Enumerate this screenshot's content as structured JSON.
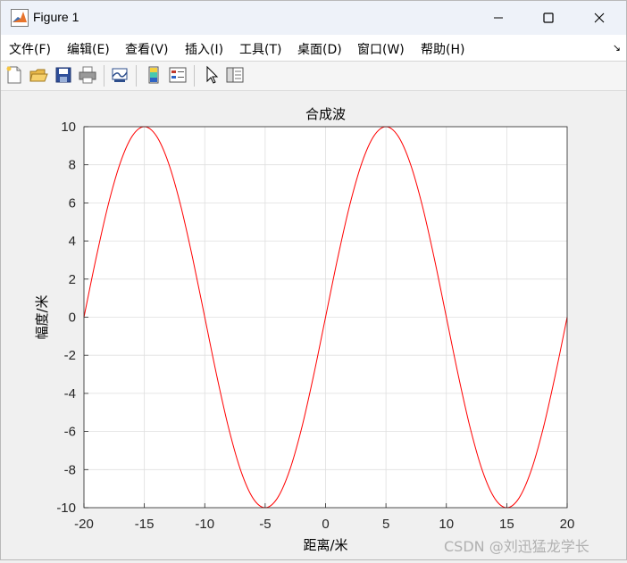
{
  "window": {
    "title": "Figure 1"
  },
  "menu": {
    "items": [
      {
        "label": "文件(F)"
      },
      {
        "label": "编辑(E)"
      },
      {
        "label": "查看(V)"
      },
      {
        "label": "插入(I)"
      },
      {
        "label": "工具(T)"
      },
      {
        "label": "桌面(D)"
      },
      {
        "label": "窗口(W)"
      },
      {
        "label": "帮助(H)"
      }
    ],
    "corner_icon": "dock-arrow-icon"
  },
  "toolbar": {
    "icons": [
      "new-figure-icon",
      "open-file-icon",
      "save-icon",
      "print-icon",
      "link-plot-icon",
      "insert-colorbar-icon",
      "insert-legend-icon",
      "edit-plot-pointer-icon",
      "property-inspector-icon"
    ]
  },
  "chart_data": {
    "type": "line",
    "title": "合成波",
    "xlabel": "距离/米",
    "ylabel": "幅度/米",
    "xlim": [
      -20,
      20
    ],
    "ylim": [
      -10,
      10
    ],
    "grid": true,
    "x_ticks": [
      "-20",
      "-15",
      "-10",
      "-5",
      "0",
      "5",
      "10",
      "15",
      "20"
    ],
    "y_ticks": [
      "10",
      "8",
      "6",
      "4",
      "2",
      "0",
      "-2",
      "-4",
      "-6",
      "-8",
      "-10"
    ],
    "series": [
      {
        "color": "#ff0000",
        "x": [
          -20,
          -19,
          -18,
          -17,
          -16,
          -15,
          -14,
          -13,
          -12,
          -11,
          -10,
          -9,
          -8,
          -7,
          -6,
          -5,
          -4,
          -3,
          -2,
          -1,
          0,
          1,
          2,
          3,
          4,
          5,
          6,
          7,
          8,
          9,
          10,
          11,
          12,
          13,
          14,
          15,
          16,
          17,
          18,
          19,
          20
        ],
        "y": [
          0,
          3.09,
          5.88,
          8.09,
          9.51,
          10,
          9.51,
          8.09,
          5.88,
          3.09,
          0,
          -3.09,
          -5.88,
          -8.09,
          -9.51,
          -10,
          -9.51,
          -8.09,
          -5.88,
          -3.09,
          0,
          3.09,
          5.88,
          8.09,
          9.51,
          10,
          9.51,
          8.09,
          5.88,
          3.09,
          0,
          -3.09,
          -5.88,
          -8.09,
          -9.51,
          -10,
          -9.51,
          -8.09,
          -5.88,
          -3.09,
          0
        ]
      }
    ]
  },
  "watermark": "CSDN @刘迅猛龙学长"
}
